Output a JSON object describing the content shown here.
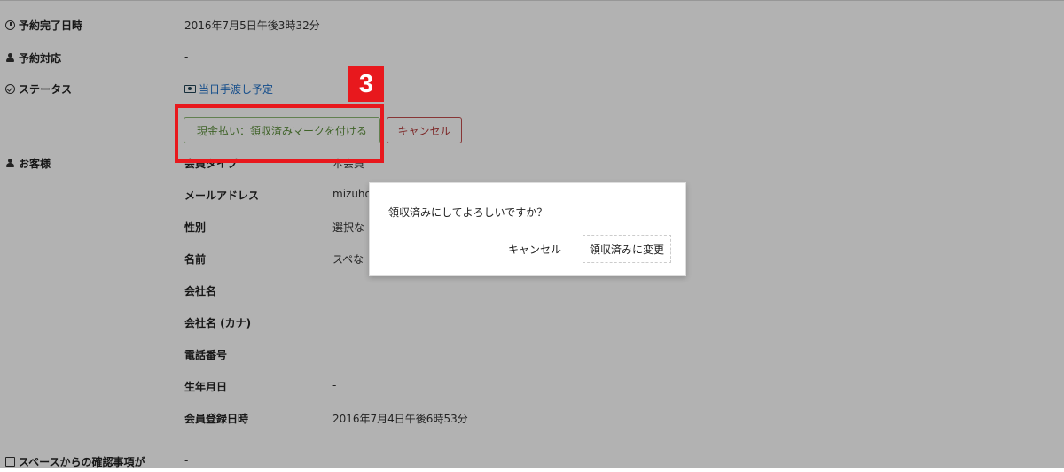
{
  "details": {
    "reservation_completed": {
      "label": "予約完了日時",
      "value": "2016年7月5日午後3時32分"
    },
    "reservation_handler": {
      "label": "予約対応",
      "value": "-"
    },
    "status": {
      "label": "ステータス",
      "value": "当日手渡し予定"
    },
    "actions": {
      "mark_received": "現金払い：領収済みマークを付ける",
      "cancel": "キャンセル"
    },
    "customer": {
      "label": "お客様",
      "fields": [
        {
          "label": "会員タイプ",
          "value": "本会員"
        },
        {
          "label": "メールアドレス",
          "value": "mizuho"
        },
        {
          "label": "性別",
          "value": "選択な"
        },
        {
          "label": "名前",
          "value": "スペな"
        },
        {
          "label": "会社名",
          "value": ""
        },
        {
          "label": "会社名 (カナ)",
          "value": ""
        },
        {
          "label": "電話番号",
          "value": ""
        },
        {
          "label": "生年月日",
          "value": "-"
        },
        {
          "label": "会員登録日時",
          "value": "2016年7月4日午後6時53分"
        }
      ]
    },
    "space_confirmation": {
      "label": "スペースからの確認事項が",
      "value": "-"
    }
  },
  "annotation": {
    "step_number": "3",
    "color": "#e8181d"
  },
  "dialog": {
    "message": "領収済みにしてよろしいですか？",
    "cancel_label": "キャンセル",
    "confirm_label": "領収済みに変更"
  },
  "icons": {
    "reservation_completed": "clock-icon",
    "reservation_handler": "user-icon",
    "status": "check-circle-icon",
    "cash": "money-icon",
    "customer": "user-icon",
    "space_confirmation": "comment-icon"
  }
}
